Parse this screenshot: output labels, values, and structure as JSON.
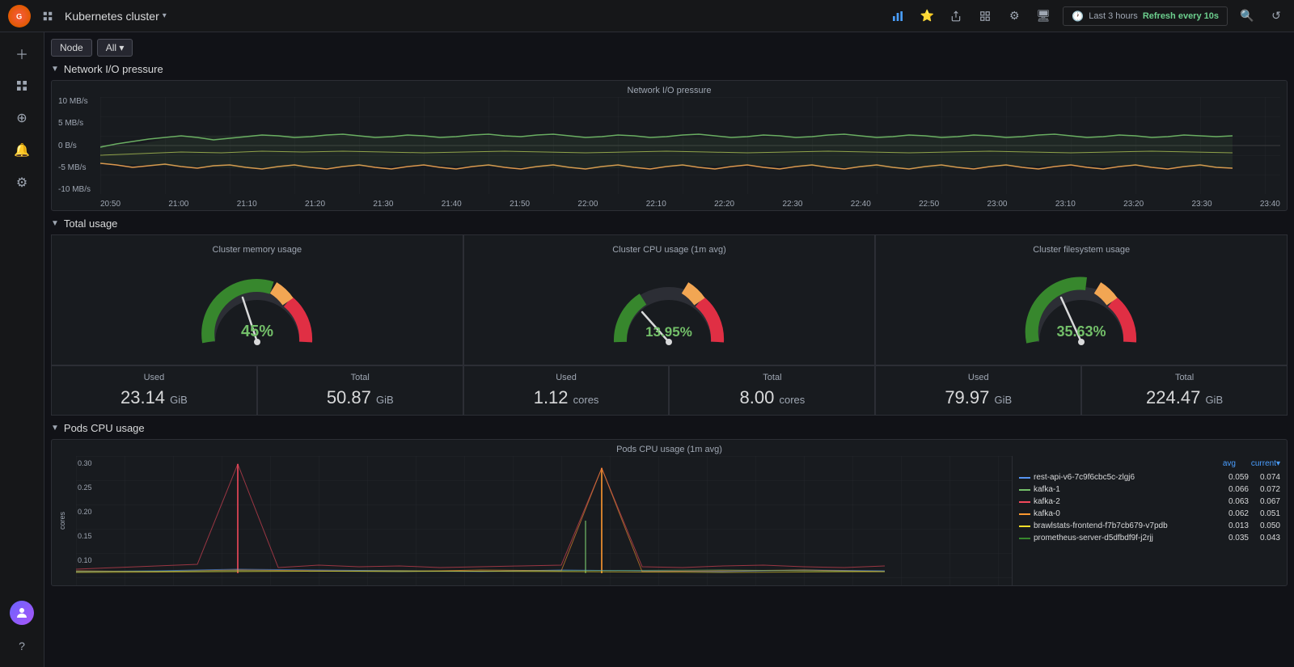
{
  "topnav": {
    "title": "Kubernetes cluster",
    "dropdown_arrow": "▾",
    "time_label": "Last 3 hours",
    "refresh_label": "Refresh every 10s"
  },
  "filter": {
    "node_label": "Node",
    "all_label": "All ▾"
  },
  "sections": {
    "network": {
      "title": "Network I/O pressure",
      "chart_title": "Network I/O pressure",
      "y_labels": [
        "10 MB/s",
        "5 MB/s",
        "0 B/s",
        "-5 MB/s",
        "-10 MB/s"
      ],
      "x_labels": [
        "20:50",
        "21:00",
        "21:10",
        "21:20",
        "21:30",
        "21:40",
        "21:50",
        "22:00",
        "22:10",
        "22:20",
        "22:30",
        "22:40",
        "22:50",
        "23:00",
        "23:10",
        "23:20",
        "23:30",
        "23:40"
      ]
    },
    "total": {
      "title": "Total usage",
      "gauges": [
        {
          "title": "Cluster memory usage",
          "percent": 45,
          "color": "#37872d"
        },
        {
          "title": "Cluster CPU usage (1m avg)",
          "percent": 13.95,
          "color": "#37872d"
        },
        {
          "title": "Cluster filesystem usage",
          "percent": 35.63,
          "color": "#37872d"
        }
      ],
      "stats": [
        {
          "label": "Used",
          "value": "23.14",
          "unit": "GiB"
        },
        {
          "label": "Total",
          "value": "50.87",
          "unit": "GiB"
        },
        {
          "label": "Used",
          "value": "1.12",
          "unit": "cores"
        },
        {
          "label": "Total",
          "value": "8.00",
          "unit": "cores"
        },
        {
          "label": "Used",
          "value": "79.97",
          "unit": "GiB"
        },
        {
          "label": "Total",
          "value": "224.47",
          "unit": "GiB"
        }
      ]
    },
    "pods": {
      "title": "Pods CPU usage",
      "chart_title": "Pods CPU usage (1m avg)",
      "y_labels": [
        "0.30",
        "0.25",
        "0.20",
        "0.15",
        "0.10"
      ],
      "y_axis_label": "cores",
      "legend_headers": [
        "avg",
        "current▾"
      ],
      "legend_items": [
        {
          "name": "rest-api-v6-7c9f6cbc5c-zlgj6",
          "color": "#5794f2",
          "avg": "0.059",
          "current": "0.074"
        },
        {
          "name": "kafka-1",
          "color": "#73bf69",
          "avg": "0.066",
          "current": "0.072"
        },
        {
          "name": "kafka-2",
          "color": "#f2495c",
          "avg": "0.063",
          "current": "0.067"
        },
        {
          "name": "kafka-0",
          "color": "#ff9830",
          "avg": "0.062",
          "current": "0.051"
        },
        {
          "name": "brawlstats-frontend-f7b7cb679-v7pdb",
          "color": "#fade2a",
          "avg": "0.013",
          "current": "0.050"
        },
        {
          "name": "prometheus-server-d5dfbdf9f-j2rjj",
          "color": "#37872d",
          "avg": "0.035",
          "current": "0.043"
        }
      ]
    }
  },
  "sidebar": {
    "icons": [
      "＋",
      "▦",
      "⊕",
      "🔔",
      "⚙"
    ]
  }
}
